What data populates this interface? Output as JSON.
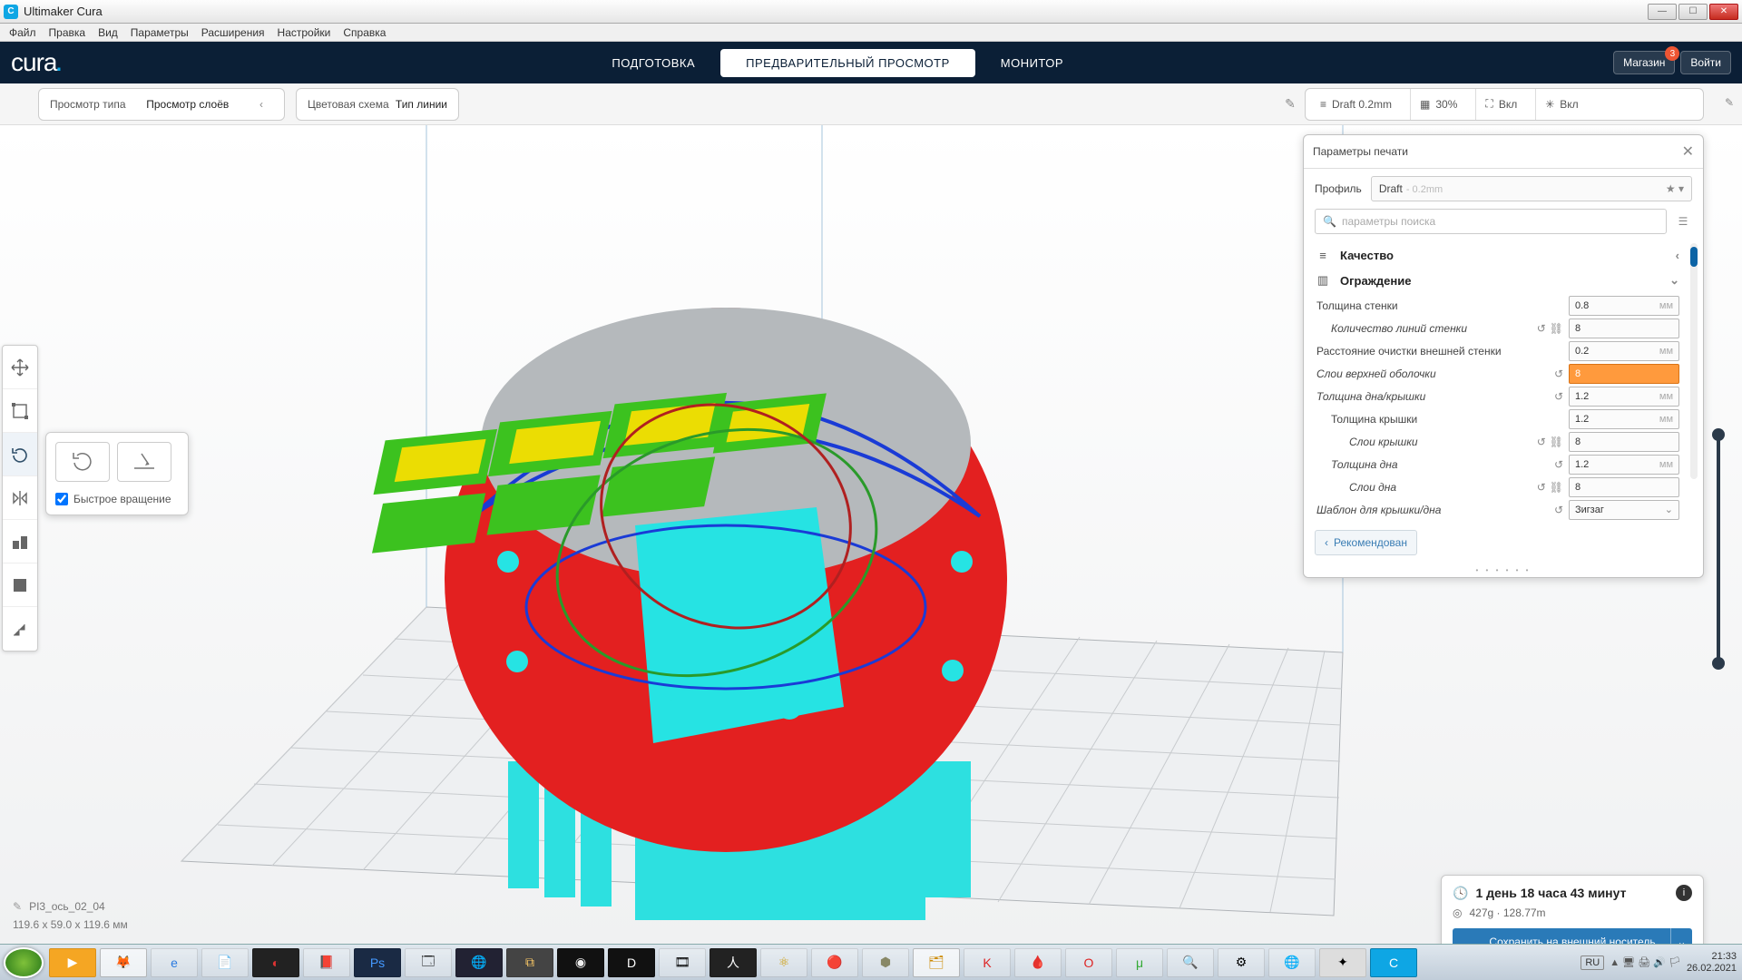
{
  "window": {
    "title": "Ultimaker Cura"
  },
  "menu": [
    "Файл",
    "Правка",
    "Вид",
    "Параметры",
    "Расширения",
    "Настройки",
    "Справка"
  ],
  "header": {
    "logo": "cura",
    "tabs": {
      "prepare": "ПОДГОТОВКА",
      "preview": "ПРЕДВАРИТЕЛЬНЫЙ ПРОСМОТР",
      "monitor": "МОНИТОР"
    },
    "market": "Магазин",
    "market_badge": "3",
    "login": "Войти"
  },
  "stage": {
    "viewtype_label": "Просмотр типа",
    "viewtype_value": "Просмотр слоёв",
    "colorscheme_label": "Цветовая схема",
    "colorscheme_value": "Тип линии",
    "summary": {
      "profile": "Draft 0.2mm",
      "infill": "30%",
      "support": "Вкл",
      "adhesion": "Вкл"
    }
  },
  "rotate_popup": {
    "fast_rotation": "Быстрое вращение",
    "checked": true
  },
  "panel": {
    "title": "Параметры печати",
    "profile_label": "Профиль",
    "profile_value": "Draft",
    "profile_sub": "- 0.2mm",
    "search_placeholder": "параметры поиска",
    "cat_quality": "Качество",
    "cat_walls": "Ограждение",
    "fields": {
      "wall_thickness": {
        "label": "Толщина стенки",
        "value": "0.8",
        "unit": "мм"
      },
      "wall_line_count": {
        "label": "Количество линий стенки",
        "value": "8"
      },
      "outer_wipe": {
        "label": "Расстояние очистки внешней стенки",
        "value": "0.2",
        "unit": "мм"
      },
      "top_layers": {
        "label": "Слои верхней оболочки",
        "value": "8"
      },
      "topbot_thickness": {
        "label": "Толщина дна/крышки",
        "value": "1.2",
        "unit": "мм"
      },
      "top_thickness": {
        "label": "Толщина крышки",
        "value": "1.2",
        "unit": "мм"
      },
      "top_layers2": {
        "label": "Слои крышки",
        "value": "8"
      },
      "bot_thickness": {
        "label": "Толщина дна",
        "value": "1.2",
        "unit": "мм"
      },
      "bot_layers": {
        "label": "Слои дна",
        "value": "8"
      },
      "topbot_pattern": {
        "label": "Шаблон для крышки/дна",
        "value": "Зигзаг"
      }
    },
    "recommended": "Рекомендован"
  },
  "object": {
    "name": "PI3_ось_02_04",
    "dims": "119.6 x 59.0 x 119.6 мм"
  },
  "estimate": {
    "time": "1 день 18 часа 43 минут",
    "material": "427g · 128.77m",
    "save": "Сохранить на внешний носитель"
  },
  "taskbar": {
    "lang": "RU",
    "time": "21:33",
    "date": "26.02.2021"
  }
}
